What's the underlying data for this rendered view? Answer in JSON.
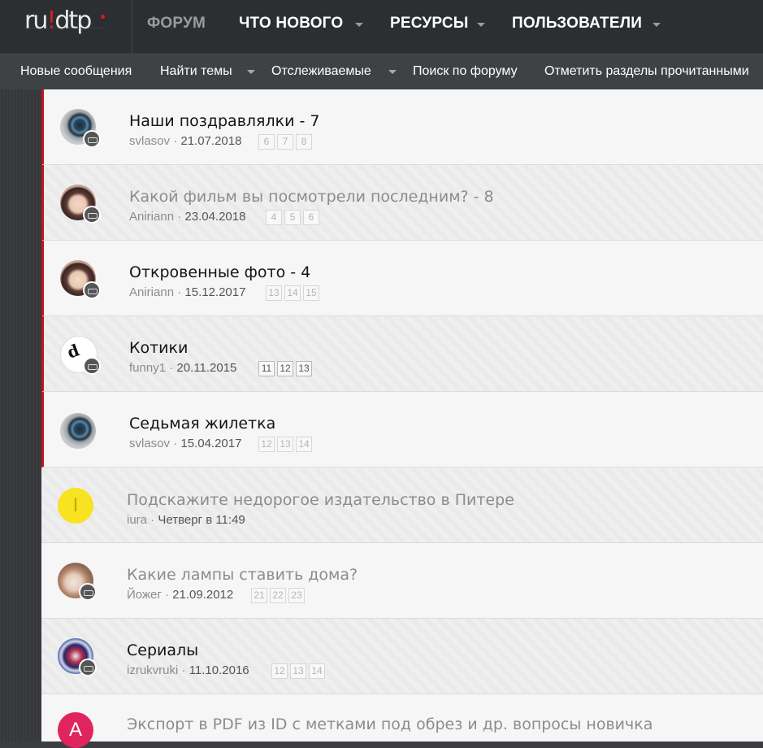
{
  "logo": {
    "text_a": "ru",
    "text_bang": "!",
    "text_b": "dtp"
  },
  "nav": {
    "forum": "ФОРУМ",
    "whats_new": "ЧТО НОВОГО",
    "resources": "РЕСУРСЫ",
    "users": "ПОЛЬЗОВАТЕЛИ"
  },
  "subnav": {
    "new_posts": "Новые сообщения",
    "find_threads": "Найти темы",
    "watched": "Отслеживаемые",
    "search_forums": "Поиск по форуму",
    "mark_read": "Отметить разделы прочитанными"
  },
  "threads": [
    {
      "title": "Наши поздравлялки - 7",
      "author": "svlasov",
      "date": "21.07.2018",
      "pages": [
        "6",
        "7",
        "8"
      ],
      "avatar": "eye-avatar",
      "read": false
    },
    {
      "title": "Какой фильм вы посмотрели последним? - 8",
      "author": "Aniriann",
      "date": "23.04.2018",
      "pages": [
        "4",
        "5",
        "6"
      ],
      "avatar": "anime-avatar",
      "read": true
    },
    {
      "title": "Откровенные фото - 4",
      "author": "Aniriann",
      "date": "15.12.2017",
      "pages": [
        "13",
        "14",
        "15"
      ],
      "avatar": "anime-avatar",
      "read": false
    },
    {
      "title": "Котики",
      "author": "funny1",
      "date": "20.11.2015",
      "pages": [
        "11",
        "12",
        "13"
      ],
      "avatar": "dtp-logo-avatar",
      "read": false
    },
    {
      "title": "Седьмая жилетка",
      "author": "svlasov",
      "date": "15.04.2017",
      "pages": [
        "12",
        "13",
        "14"
      ],
      "avatar": "eye-avatar",
      "read": false
    },
    {
      "title": "Подскажите недорогое издательство в Питере",
      "author": "iura",
      "date": "Четверг в 11:49",
      "pages": [],
      "avatar": "letter-avatar",
      "avatar_letter": "I",
      "avatar_color": "#f7e321",
      "read": true
    },
    {
      "title": "Какие лампы ставить дома?",
      "author": "Йожег",
      "date": "21.09.2012",
      "pages": [
        "21",
        "22",
        "23"
      ],
      "avatar": "hamster-avatar",
      "read": true
    },
    {
      "title": "Сериалы",
      "author": "izrukvruki",
      "date": "11.10.2016",
      "pages": [
        "12",
        "13",
        "14"
      ],
      "avatar": "cubes-avatar",
      "read": false
    },
    {
      "title": "Экспорт в PDF из ID с метками под обрез и др. вопросы новичка",
      "author": "",
      "date": "",
      "pages": [],
      "avatar": "letter-avatar",
      "avatar_letter": "A",
      "avatar_color": "#e0245e",
      "read": true
    }
  ],
  "colors": {
    "accent": "#c0161f",
    "topbar": "#2c2f31",
    "subbar": "#3f4244"
  }
}
